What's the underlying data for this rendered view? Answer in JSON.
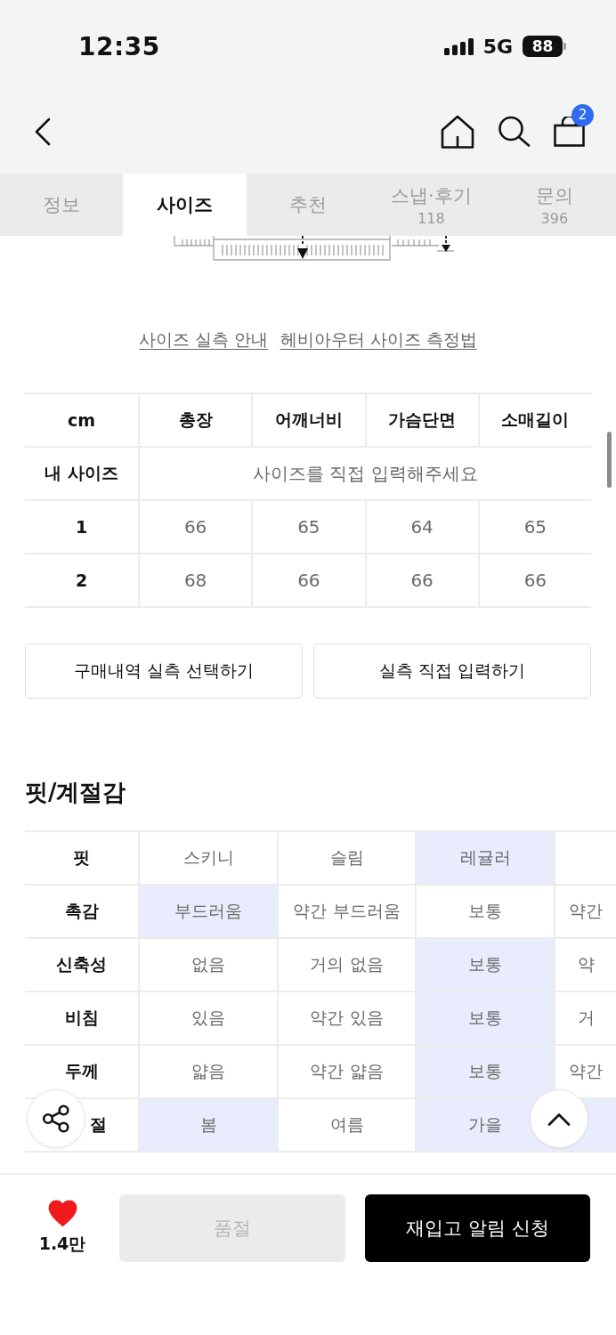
{
  "status_bar": {
    "time": "12:35",
    "network": "5G",
    "battery": "88"
  },
  "nav_bar": {
    "cart_count": "2"
  },
  "tabs": [
    {
      "label": "정보",
      "selected": false
    },
    {
      "label": "사이즈",
      "selected": true
    },
    {
      "label": "추천",
      "selected": false
    },
    {
      "label": "스냅·후기",
      "count": "118",
      "selected": false
    },
    {
      "label": "문의",
      "count": "396",
      "selected": false
    }
  ],
  "size_guide_links": [
    "사이즈 실측 안내",
    "헤비아우터 사이즈 측정법"
  ],
  "size_table": {
    "columns": [
      "cm",
      "총장",
      "어깨너비",
      "가슴단면",
      "소매길이"
    ],
    "my_size": {
      "label": "내 사이즈",
      "prompt": "사이즈를 직접 입력해주세요"
    },
    "rows": [
      {
        "size": "1",
        "values": [
          "66",
          "65",
          "64",
          "65"
        ]
      },
      {
        "size": "2",
        "values": [
          "68",
          "66",
          "66",
          "66"
        ]
      }
    ]
  },
  "size_buttons": [
    "구매내역 실측 선택하기",
    "실측 직접 입력하기"
  ],
  "fit_section": {
    "title": "핏/계절감",
    "rows": [
      {
        "label": "핏",
        "label_partly_hidden": false,
        "options": [
          {
            "text": "스키니",
            "selected": false
          },
          {
            "text": "슬림",
            "selected": false
          },
          {
            "text": "레귤러",
            "selected": true
          },
          {
            "selected": false
          }
        ]
      },
      {
        "label": "촉감",
        "label_partly_hidden": false,
        "options": [
          {
            "text": "부드러움",
            "selected": true
          },
          {
            "text": "약간 부드러움",
            "selected": false
          },
          {
            "text": "보통",
            "selected": false
          },
          {
            "text": "약간",
            "selected": false
          }
        ]
      },
      {
        "label": "신축성",
        "label_partly_hidden": false,
        "options": [
          {
            "text": "없음",
            "selected": false
          },
          {
            "text": "거의 없음",
            "selected": false
          },
          {
            "text": "보통",
            "selected": true
          },
          {
            "text": "약",
            "selected": false
          }
        ]
      },
      {
        "label": "비침",
        "label_partly_hidden": false,
        "options": [
          {
            "text": "있음",
            "selected": false
          },
          {
            "text": "약간 있음",
            "selected": false
          },
          {
            "text": "보통",
            "selected": true
          },
          {
            "text": "거",
            "selected": false
          }
        ]
      },
      {
        "label": "두께",
        "label_partly_hidden": false,
        "options": [
          {
            "text": "얇음",
            "selected": false
          },
          {
            "text": "약간 얇음",
            "selected": false
          },
          {
            "text": "보통",
            "selected": true
          },
          {
            "text": "약간",
            "selected": false
          }
        ]
      },
      {
        "label": "절",
        "label_partly_hidden": true,
        "options": [
          {
            "text": "봄",
            "selected": true
          },
          {
            "text": "여름",
            "selected": false
          },
          {
            "text": "가을",
            "selected": true
          },
          {
            "selected": true
          }
        ]
      }
    ]
  },
  "bottom_bar": {
    "liked": true,
    "likes": "1.4만",
    "sold_out_button": {
      "label": "품절",
      "disabled": true
    },
    "restock_button": {
      "label": "재입고 알림 신청"
    }
  }
}
